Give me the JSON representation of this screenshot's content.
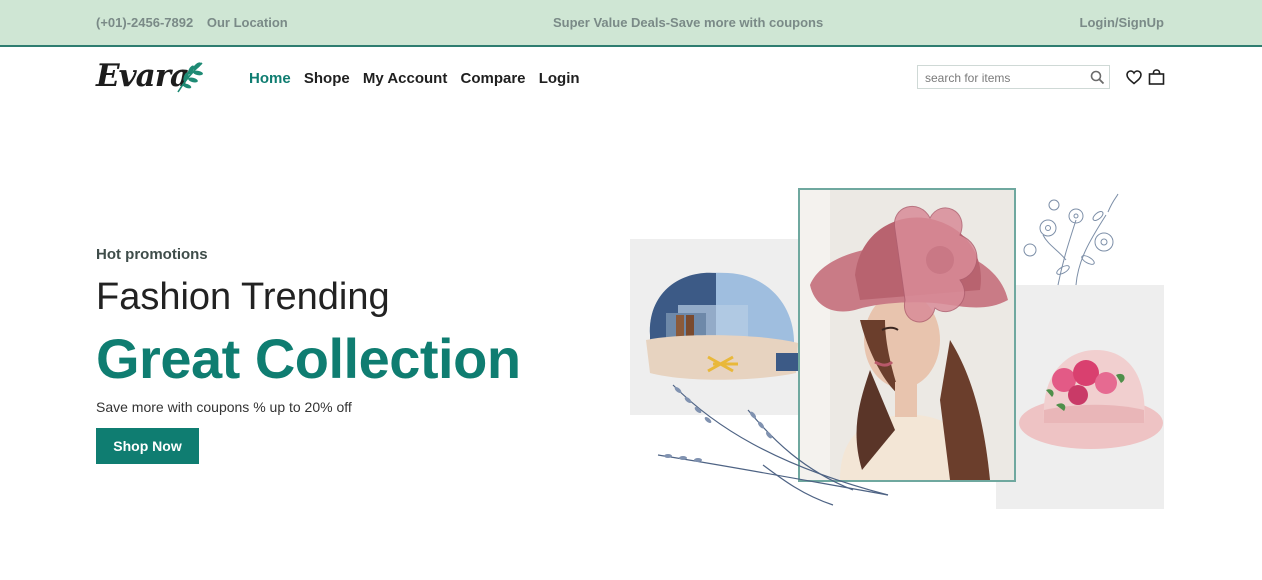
{
  "topbar": {
    "phone": "(+01)-2456-7892",
    "location": "Our Location",
    "promo": "Super Value Deals-Save more with coupons",
    "auth": "Login/SignUp"
  },
  "brand": {
    "logo_text": "Evara"
  },
  "nav": {
    "items": [
      "Home",
      "Shope",
      "My Account",
      "Compare",
      "Login"
    ],
    "active": "Home"
  },
  "search": {
    "placeholder": "search for items",
    "value": ""
  },
  "icons": {
    "search": "search-icon",
    "wishlist": "heart-icon",
    "cart": "shopping-bag-icon"
  },
  "hero": {
    "eyebrow": "Hot promotions",
    "title": "Fashion Trending",
    "headline": "Great Collection",
    "subtitle": "Save more with coupons % up to 20% off",
    "cta": "Shop Now",
    "images": [
      "denim-cap",
      "woman-in-pink-hat",
      "pink-floral-hat",
      "flower-sketch",
      "lavender-sketch"
    ]
  },
  "colors": {
    "accent": "#0f7d71",
    "topbar_bg": "#cfe6d4",
    "text": "#222222"
  }
}
